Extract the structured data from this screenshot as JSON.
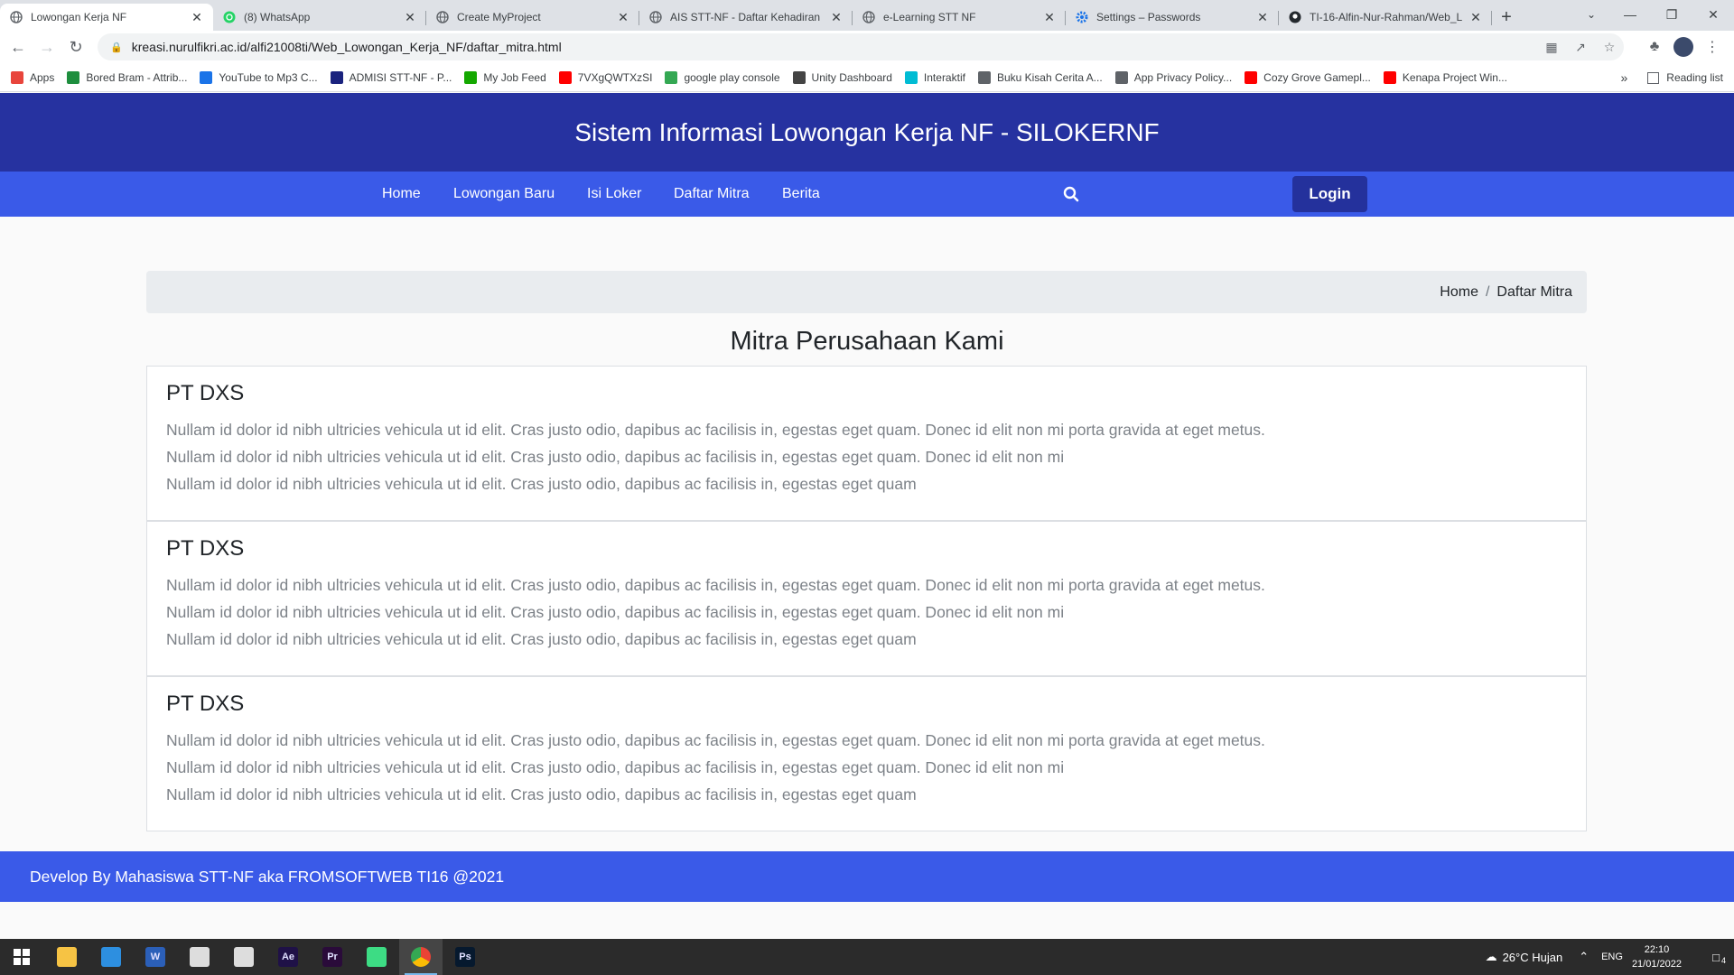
{
  "browser": {
    "tabs": [
      {
        "title": "Lowongan Kerja NF",
        "active": true,
        "icon": "globe-icon"
      },
      {
        "title": "(8) WhatsApp",
        "active": false,
        "icon": "whatsapp-icon"
      },
      {
        "title": "Create MyProject",
        "active": false,
        "icon": "globe-icon"
      },
      {
        "title": "AIS STT-NF - Daftar Kehadiran",
        "active": false,
        "icon": "globe-icon"
      },
      {
        "title": "e-Learning STT NF",
        "active": false,
        "icon": "globe-icon"
      },
      {
        "title": "Settings – Passwords",
        "active": false,
        "icon": "gear-icon"
      },
      {
        "title": "TI-16-Alfin-Nur-Rahman/Web_L",
        "active": false,
        "icon": "github-icon"
      }
    ],
    "url": "kreasi.nurulfikri.ac.id/alfi21008ti/Web_Lowongan_Kerja_NF/daftar_mitra.html",
    "bookmarks": [
      {
        "label": "Apps",
        "color": "#e8453c"
      },
      {
        "label": "Bored Bram - Attrib...",
        "color": "#1e8e3e"
      },
      {
        "label": "YouTube to Mp3 C...",
        "color": "#1a73e8"
      },
      {
        "label": "ADMISI STT-NF - P...",
        "color": "#1a237e"
      },
      {
        "label": "My Job Feed",
        "color": "#14a800"
      },
      {
        "label": "7VXgQWTXzSI",
        "color": "#ff0000"
      },
      {
        "label": "google play console",
        "color": "#34a853"
      },
      {
        "label": "Unity Dashboard",
        "color": "#444444"
      },
      {
        "label": "Interaktif",
        "color": "#00bcd4"
      },
      {
        "label": "Buku Kisah Cerita A...",
        "color": "#5f6368"
      },
      {
        "label": "App Privacy Policy...",
        "color": "#5f6368"
      },
      {
        "label": "Cozy Grove Gamepl...",
        "color": "#ff0000"
      },
      {
        "label": "Kenapa Project Win...",
        "color": "#ff0000"
      }
    ],
    "reading_list": "Reading list"
  },
  "site": {
    "title": "Sistem Informasi Lowongan Kerja NF - SILOKERNF",
    "nav": [
      "Home",
      "Lowongan Baru",
      "Isi Loker",
      "Daftar Mitra",
      "Berita"
    ],
    "login_label": "Login",
    "breadcrumb": {
      "home": "Home",
      "current": "Daftar Mitra"
    },
    "heading": "Mitra Perusahaan Kami",
    "partners": [
      {
        "name": "PT DXS",
        "lines": [
          "Nullam id dolor id nibh ultricies vehicula ut id elit. Cras justo odio, dapibus ac facilisis in, egestas eget quam. Donec id elit non mi porta gravida at eget metus.",
          "Nullam id dolor id nibh ultricies vehicula ut id elit. Cras justo odio, dapibus ac facilisis in, egestas eget quam. Donec id elit non mi",
          "Nullam id dolor id nibh ultricies vehicula ut id elit. Cras justo odio, dapibus ac facilisis in, egestas eget quam"
        ]
      },
      {
        "name": "PT DXS",
        "lines": [
          "Nullam id dolor id nibh ultricies vehicula ut id elit. Cras justo odio, dapibus ac facilisis in, egestas eget quam. Donec id elit non mi porta gravida at eget metus.",
          "Nullam id dolor id nibh ultricies vehicula ut id elit. Cras justo odio, dapibus ac facilisis in, egestas eget quam. Donec id elit non mi",
          "Nullam id dolor id nibh ultricies vehicula ut id elit. Cras justo odio, dapibus ac facilisis in, egestas eget quam"
        ]
      },
      {
        "name": "PT DXS",
        "lines": [
          "Nullam id dolor id nibh ultricies vehicula ut id elit. Cras justo odio, dapibus ac facilisis in, egestas eget quam. Donec id elit non mi porta gravida at eget metus.",
          "Nullam id dolor id nibh ultricies vehicula ut id elit. Cras justo odio, dapibus ac facilisis in, egestas eget quam. Donec id elit non mi",
          "Nullam id dolor id nibh ultricies vehicula ut id elit. Cras justo odio, dapibus ac facilisis in, egestas eget quam"
        ]
      }
    ],
    "footer": "Develop By Mahasiswa STT-NF aka FROMSOFTWEB TI16 @2021",
    "colors": {
      "header": "#2632a0",
      "nav": "#3a5ae8",
      "login": "#24319c"
    }
  },
  "taskbar": {
    "apps": [
      {
        "name": "file-explorer-icon",
        "label": "",
        "color": "#f6c344"
      },
      {
        "name": "vscode-icon",
        "label": "",
        "color": "#2d8fe0"
      },
      {
        "name": "word-icon",
        "label": "W",
        "color": "#2b5fb8"
      },
      {
        "name": "unity-icon",
        "label": "",
        "color": "#dddddd"
      },
      {
        "name": "app-icon",
        "label": "",
        "color": "#dddddd"
      },
      {
        "name": "after-effects-icon",
        "label": "Ae",
        "color": "#1f1147"
      },
      {
        "name": "premiere-icon",
        "label": "Pr",
        "color": "#2a0b3a"
      },
      {
        "name": "android-studio-icon",
        "label": "",
        "color": "#3ddc84"
      },
      {
        "name": "chrome-icon",
        "label": "",
        "color": "#ea4335",
        "active": true
      },
      {
        "name": "photoshop-icon",
        "label": "Ps",
        "color": "#06192e"
      }
    ],
    "weather": "26°C  Hujan",
    "language": "ENG",
    "time": "22:10",
    "date": "21/01/2022",
    "notifications": "4"
  }
}
